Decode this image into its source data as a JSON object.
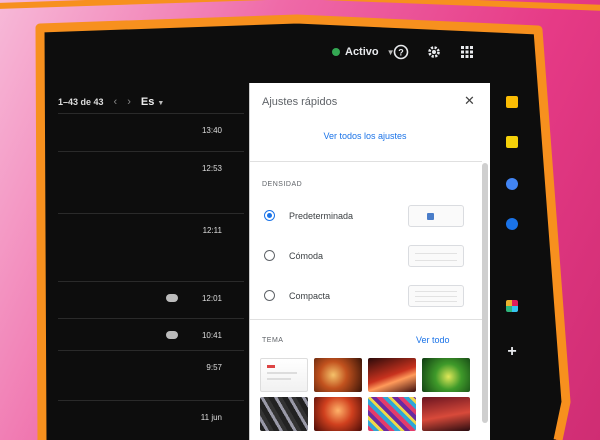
{
  "topbar": {
    "status_label": "Activo",
    "status_color": "#34a853",
    "icons": [
      "help-icon",
      "gear-icon",
      "apps-grid-icon",
      "avatar"
    ]
  },
  "list": {
    "pager_text": "1–43 de 43",
    "lang_label": "Es",
    "rows": [
      {
        "time": "13:40",
        "attachment": false
      },
      {
        "time": "12:53",
        "attachment": false
      },
      {
        "time": "12:11",
        "attachment": false
      },
      {
        "time": "12:01",
        "attachment": true
      },
      {
        "time": "10:41",
        "attachment": true
      },
      {
        "time": "9:57",
        "attachment": false
      },
      {
        "time": "11 jun",
        "attachment": false
      }
    ]
  },
  "quick_settings": {
    "title": "Ajustes rápidos",
    "see_all_settings": "Ver todos los ajustes",
    "density_label": "DENSIDAD",
    "density_options": [
      {
        "label": "Predeterminada",
        "selected": true
      },
      {
        "label": "Cómoda",
        "selected": false
      },
      {
        "label": "Compacta",
        "selected": false
      }
    ],
    "theme_label": "TEMA",
    "see_all_themes": "Ver todo",
    "accent_color": "#1a73e8"
  },
  "rail": {
    "icons": [
      "keep-icon",
      "tasks-icon",
      "calendar-icon",
      "contacts-icon",
      "slack-icon",
      "add-icon"
    ]
  }
}
